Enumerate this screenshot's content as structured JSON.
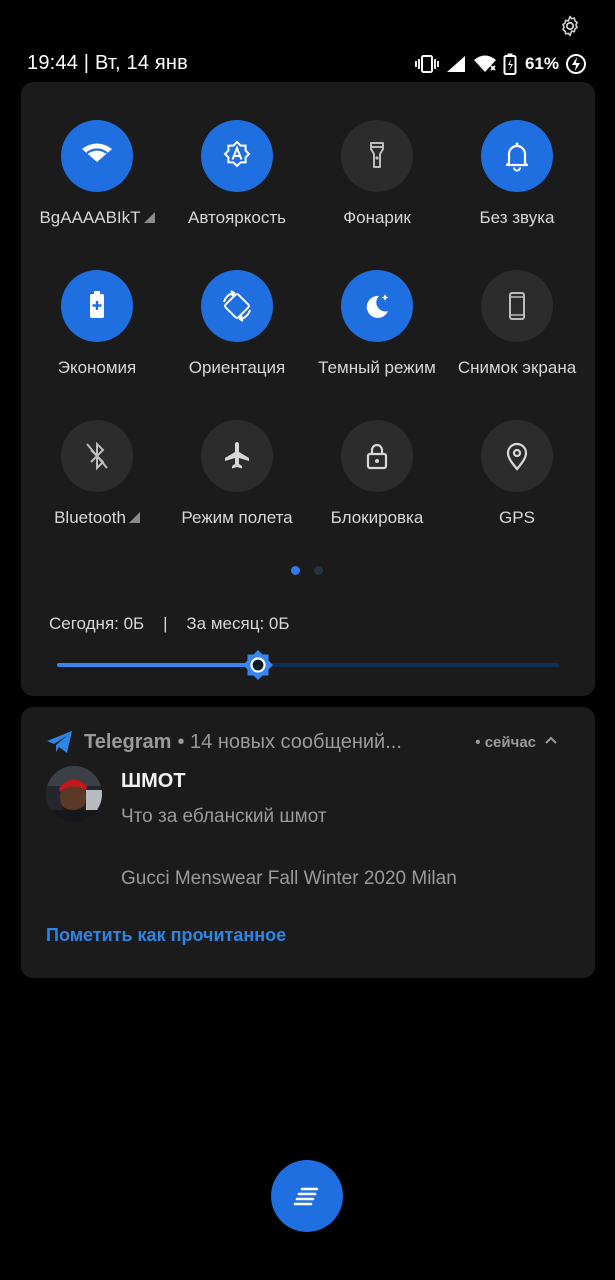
{
  "status_bar": {
    "time_date": "19:44 | Вт, 14 янв",
    "battery_percent": "61%",
    "icons": [
      "vibrate-icon",
      "cell-signal-icon",
      "wifi-icon",
      "battery-icon",
      "charging-icon"
    ]
  },
  "settings_icon": "gear-icon",
  "quick_settings": {
    "tiles": [
      {
        "label": "BgAAAABIkT",
        "icon": "wifi-icon",
        "on": true,
        "expand": true
      },
      {
        "label": "Автояркость",
        "icon": "auto-brightness-icon",
        "on": true,
        "expand": false
      },
      {
        "label": "Фонарик",
        "icon": "flashlight-icon",
        "on": false,
        "expand": false
      },
      {
        "label": "Без звука",
        "icon": "bell-icon",
        "on": true,
        "expand": false
      },
      {
        "label": "Экономия",
        "icon": "battery-saver-icon",
        "on": true,
        "expand": false
      },
      {
        "label": "Ориентация",
        "icon": "rotate-icon",
        "on": true,
        "expand": false
      },
      {
        "label": "Темный режим",
        "icon": "dark-mode-icon",
        "on": true,
        "expand": false
      },
      {
        "label": "Снимок экрана",
        "icon": "screenshot-icon",
        "on": false,
        "expand": false
      },
      {
        "label": "Bluetooth",
        "icon": "bluetooth-off-icon",
        "on": false,
        "expand": true
      },
      {
        "label": "Режим полета",
        "icon": "airplane-icon",
        "on": false,
        "expand": false
      },
      {
        "label": "Блокировка",
        "icon": "lock-icon",
        "on": false,
        "expand": false
      },
      {
        "label": "GPS",
        "icon": "location-icon",
        "on": false,
        "expand": false
      }
    ],
    "page_count": 2,
    "current_page": 1,
    "usage_text": "Сегодня: 0Б    |    За месяц: 0Б",
    "brightness_level": 0.4
  },
  "notification": {
    "app_name": "Telegram",
    "summary": "• 14 новых сообщений...",
    "time": "• сейчас",
    "title": "ШМОТ",
    "message": "Что за ебланский шмот",
    "message2": "Gucci Menswear Fall Winter 2020 Milan",
    "action_label": "Пометить как прочитанное"
  },
  "colors": {
    "accent": "#1f6fe0",
    "tile_off": "#2c2c2c",
    "panel": "#1b1b1b",
    "action": "#2d86e6"
  }
}
